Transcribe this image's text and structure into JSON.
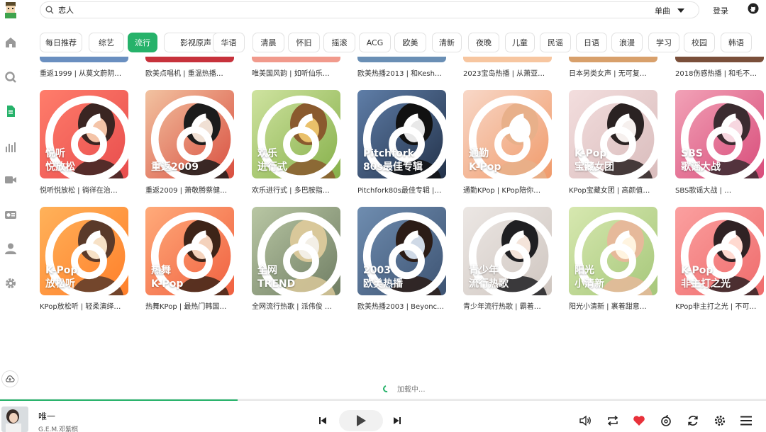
{
  "header": {
    "search_value": "恋人",
    "search_type": "单曲",
    "login_label": "登录"
  },
  "tags": [
    "每日推荐",
    "综艺",
    "流行",
    "影视原声",
    "华语",
    "清晨",
    "怀旧",
    "摇滚",
    "ACG",
    "欧美",
    "清新",
    "夜晚",
    "儿童",
    "民谣",
    "日语",
    "浪漫",
    "学习",
    "校园",
    "韩语"
  ],
  "active_tag": "流行",
  "partial_row": [
    "重返1999 | 从莫文蔚阴…",
    "欧美点唱机 | 重温热播…",
    "唯美国风韵 | 如听仙乐…",
    "欧美热播2013 | 和Kesh…",
    "2023宝岛热播 | 从萧亚…",
    "日本另类女声 | 无可复…",
    "2018伤感热播 | 和毛不…"
  ],
  "row1": [
    {
      "cover_l1": "悦听",
      "cover_l2": "悦放松",
      "title": "悦听悦放松 | 徜徉在治…"
    },
    {
      "cover_l1": "",
      "cover_l2": "重返2009",
      "title": "重返2009 | 萧敬腾蔡健…"
    },
    {
      "cover_l1": "欢乐",
      "cover_l2": "进行式",
      "title": "欢乐进行式 | 多巴胺指…"
    },
    {
      "cover_l1": "Pitchfork",
      "cover_l2": "80s最佳专辑",
      "title": "Pitchfork80s最佳专辑 |…"
    },
    {
      "cover_l1": "通勤",
      "cover_l2": "K-Pop",
      "title": "通勤KPop | KPop陪你…"
    },
    {
      "cover_l1": "K-Pop",
      "cover_l2": "宝藏女团",
      "title": "KPop宝藏女团 | 高颜值…"
    },
    {
      "cover_l1": "SBS",
      "cover_l2": "歌谣大战",
      "title": "SBS歌谣大战 | …"
    }
  ],
  "row2": [
    {
      "cover_l1": "K-Pop",
      "cover_l2": "放松听",
      "title": "KPop放松听 | 轻柔演绎…"
    },
    {
      "cover_l1": "热舞",
      "cover_l2": "K-Pop",
      "title": "热舞KPop | 最热门韩国…"
    },
    {
      "cover_l1": "全网",
      "cover_l2": "TREND",
      "title": "全网流行热歌 | 派伟俊 …"
    },
    {
      "cover_l1": "2003",
      "cover_l2": "欧美热播",
      "title": "欧美热播2003 | Beyonc…"
    },
    {
      "cover_l1": "青少年",
      "cover_l2": "流行热歌",
      "title": "青少年流行热歌 | 霸着…"
    },
    {
      "cover_l1": "阳光",
      "cover_l2": "小清新",
      "title": "阳光小清新 | 裹着甜意…"
    },
    {
      "cover_l1": "K-Pop",
      "cover_l2": "非主打之光",
      "title": "KPop非主打之光 | 不可…"
    }
  ],
  "loading_text": "加载中...",
  "player": {
    "song_title": "唯一",
    "artist": "G.E.M.邓紫棋",
    "progress": 0.31
  },
  "colors": {
    "accent": "#26b26a",
    "heart": "#e8313a"
  }
}
